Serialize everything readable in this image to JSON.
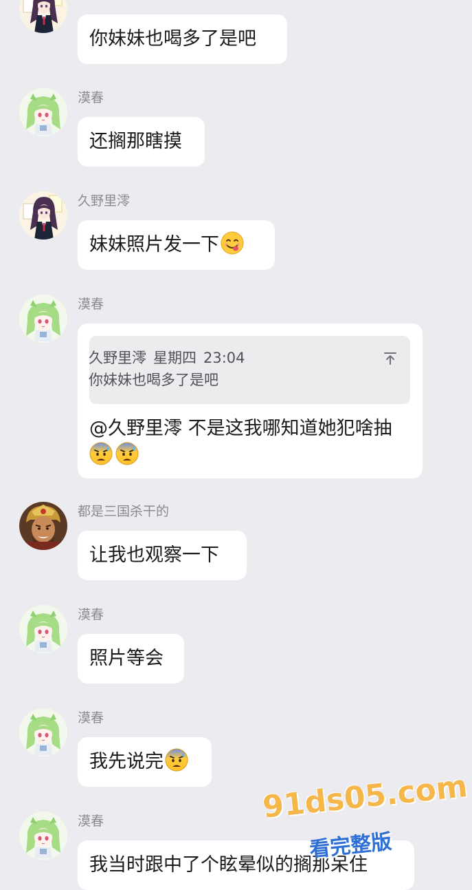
{
  "messages": [
    {
      "sender": "",
      "avatar": "avatar-portrait-girl",
      "text": "你妹妹也喝多了是吧",
      "emoji": ""
    },
    {
      "sender": "漠春",
      "avatar": "avatar-green-hair",
      "text": "还搁那瞎摸",
      "emoji": ""
    },
    {
      "sender": "久野里澪",
      "avatar": "avatar-portrait-girl",
      "text": "妹妹照片发一下",
      "emoji": "yum-face-emoji"
    },
    {
      "sender": "都是三国杀干的",
      "avatar": "avatar-warrior",
      "text": "让我也观察一下",
      "emoji": ""
    },
    {
      "sender": "漠春",
      "avatar": "avatar-green-hair",
      "text": "照片等会",
      "emoji": ""
    },
    {
      "sender": "漠春",
      "avatar": "avatar-green-hair",
      "text": "我先说完",
      "emoji": "anxious-sweat-face-emoji"
    },
    {
      "sender": "漠春",
      "avatar": "avatar-green-hair",
      "text": "我当时跟中了个眩晕似的搁那呆住",
      "emoji": ""
    }
  ],
  "reply_message": {
    "sender": "漠春",
    "avatar": "avatar-green-hair",
    "quote": {
      "author": "久野里澪",
      "day": "星期四",
      "time": "23:04",
      "text": "你妹妹也喝多了是吧",
      "jump_icon": "arrow-up-icon"
    },
    "text": "@久野里澪 不是这我哪知道她犯啥抽",
    "emojis": [
      "anxious-sweat-face-emoji",
      "anxious-sweat-face-emoji"
    ]
  },
  "watermark": {
    "url": "91ds05.com",
    "subtitle": "看完整版",
    "colors": {
      "url": "#f5b64a",
      "subtitle": "#2e6fd6"
    }
  },
  "theme": {
    "background": "#ebebf0",
    "bubble": "#ffffff",
    "sender_text": "#8a8a90"
  }
}
